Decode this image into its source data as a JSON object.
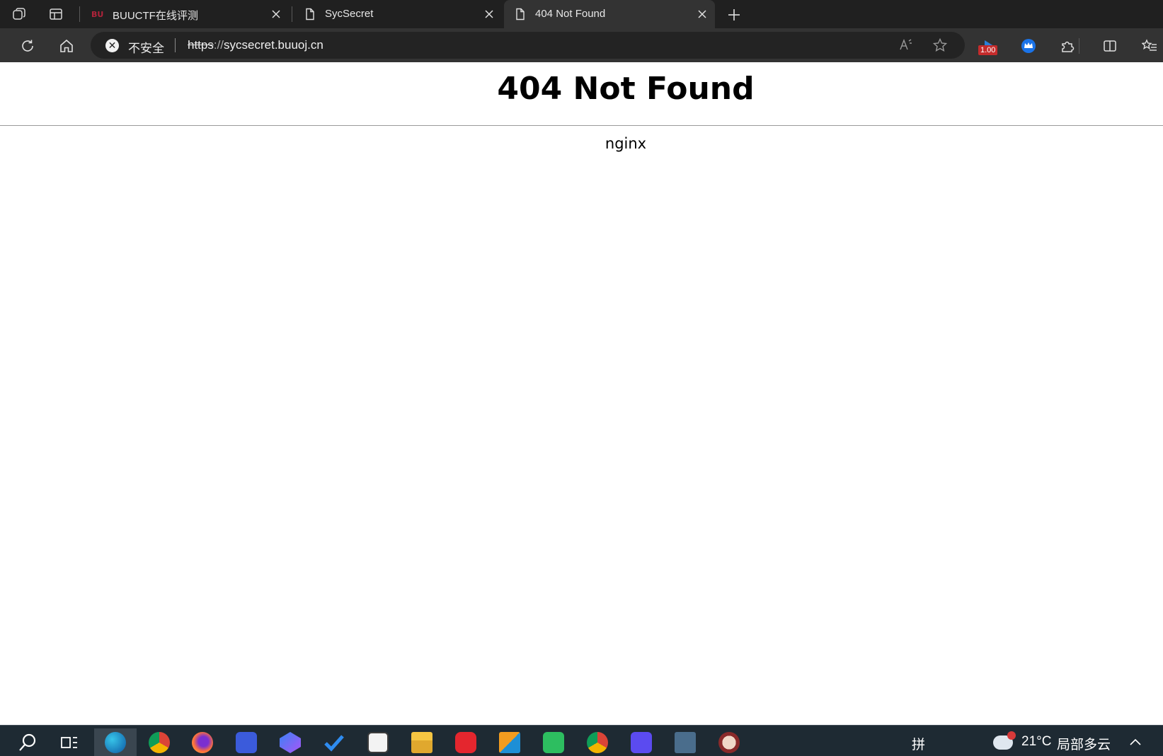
{
  "browser": {
    "tabs": [
      {
        "title": "BUUCTF在线评测",
        "favicon": "buuctf-logo-icon",
        "active": false
      },
      {
        "title": "SycSecret",
        "favicon": "page-icon",
        "active": false
      },
      {
        "title": "404 Not Found",
        "favicon": "page-icon",
        "active": true
      }
    ],
    "address_bar": {
      "security_label": "不安全",
      "url_scheme": "https",
      "url_separator": "://",
      "url_host": "sycsecret.buuoj.cn"
    },
    "extension_badge": "1.00"
  },
  "page": {
    "heading": "404 Not Found",
    "server": "nginx"
  },
  "taskbar": {
    "apps": [
      "search",
      "task-view",
      "edge",
      "chrome",
      "firefox",
      "vscode",
      "copilot",
      "todo",
      "store",
      "explorer",
      "netease-music",
      "vmware",
      "evernote",
      "chrome-canary",
      "lightning",
      "calculator",
      "avatar"
    ],
    "ime_indicator": "拼",
    "weather_temp": "21°C",
    "weather_desc": "局部多云"
  }
}
